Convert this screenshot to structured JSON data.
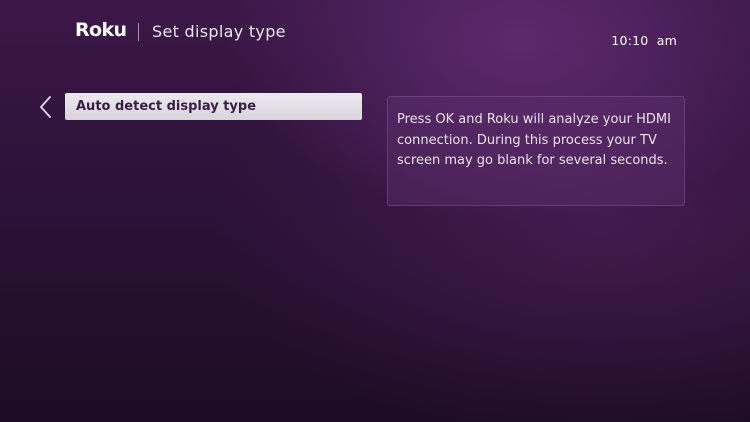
{
  "header": {
    "logo_text": "Roku",
    "title": "Set display type",
    "clock": "10:10  am"
  },
  "menu": {
    "back_icon": "chevron-left-icon",
    "items": [
      {
        "label": "Auto detect display type",
        "selected": true
      }
    ]
  },
  "info_panel": {
    "text": "Press OK and Roku will analyze your HDMI connection. During this process your TV screen may go blank for several seconds."
  },
  "colors": {
    "background": "#2d1238",
    "selected_item_bg": "#e6e2e8",
    "selected_item_text": "#3a1d46"
  }
}
